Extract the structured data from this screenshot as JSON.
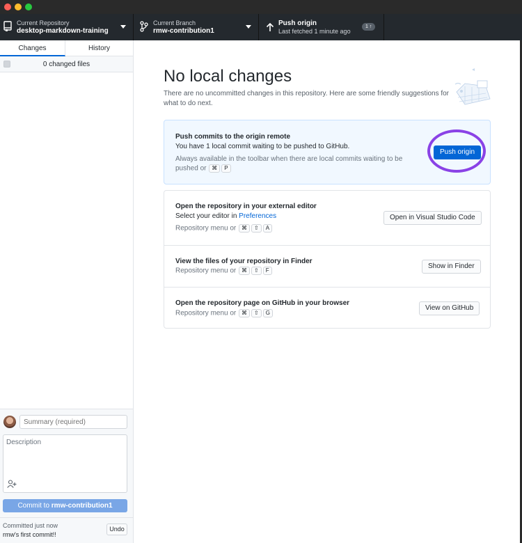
{
  "toolbar": {
    "repo": {
      "label": "Current Repository",
      "value": "desktop-markdown-training"
    },
    "branch": {
      "label": "Current Branch",
      "value": "rmw-contribution1"
    },
    "push": {
      "label": "Push origin",
      "sub": "Last fetched 1 minute ago",
      "badge": "1 ↑"
    }
  },
  "sidebar": {
    "tabs": [
      {
        "label": "Changes"
      },
      {
        "label": "History"
      }
    ],
    "changed_files": "0 changed files",
    "summary_placeholder": "Summary (required)",
    "description_placeholder": "Description",
    "commit_button": {
      "prefix": "Commit to ",
      "branch": "rmw-contribution1"
    },
    "undo": {
      "time": "Committed just now",
      "message": "rmw's first commit!!",
      "button": "Undo"
    }
  },
  "main": {
    "title": "No local changes",
    "description": "There are no uncommitted changes in this repository. Here are some friendly suggestions for what to do next.",
    "push_card": {
      "title": "Push commits to the origin remote",
      "text": "You have 1 local commit waiting to be pushed to GitHub.",
      "hint_line1": "Always available in the toolbar when there are local commits waiting to be",
      "hint_line2_prefix": "pushed or",
      "keys": [
        "⌘",
        "P"
      ],
      "button": "Push origin"
    },
    "editor_row": {
      "title": "Open the repository in your external editor",
      "text_prefix": "Select your editor in ",
      "link": "Preferences",
      "hint_prefix": "Repository menu or",
      "keys": [
        "⌘",
        "⇧",
        "A"
      ],
      "button": "Open in Visual Studio Code"
    },
    "finder_row": {
      "title": "View the files of your repository in Finder",
      "hint_prefix": "Repository menu or",
      "keys": [
        "⌘",
        "⇧",
        "F"
      ],
      "button": "Show in Finder"
    },
    "github_row": {
      "title": "Open the repository page on GitHub in your browser",
      "hint_prefix": "Repository menu or",
      "keys": [
        "⌘",
        "⇧",
        "G"
      ],
      "button": "View on GitHub"
    }
  },
  "colors": {
    "accent": "#0366d6",
    "highlight_ring": "#8a42e6",
    "toolbar_bg": "#24292e"
  }
}
